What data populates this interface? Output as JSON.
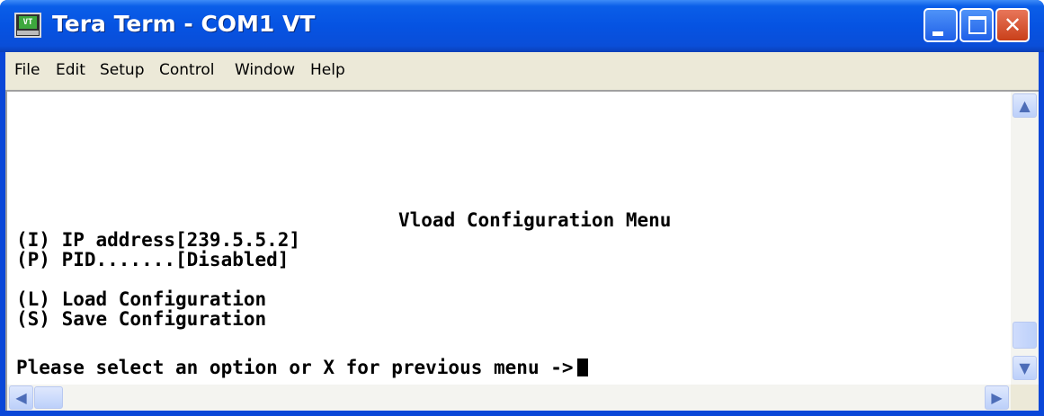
{
  "window": {
    "title": "Tera Term - COM1 VT",
    "icon_label": "VT"
  },
  "title_buttons": {
    "minimize_glyph": "",
    "close_glyph": "✕"
  },
  "menu": [
    "File",
    "Edit",
    "Setup",
    "Control",
    "Window",
    "Help"
  ],
  "terminal": {
    "heading": "Vload Configuration Menu",
    "options": [
      "(I) IP address[239.5.5.2]",
      "(P) PID.......[Disabled]",
      "(L) Load Configuration",
      "(S) Save Configuration"
    ],
    "prompt": "Please select an option or X for previous menu ->"
  },
  "icons": [
    "minimize-icon",
    "maximize-icon",
    "close-icon",
    "scroll-up-icon",
    "scroll-down-icon",
    "scroll-left-icon",
    "scroll-right-icon"
  ]
}
